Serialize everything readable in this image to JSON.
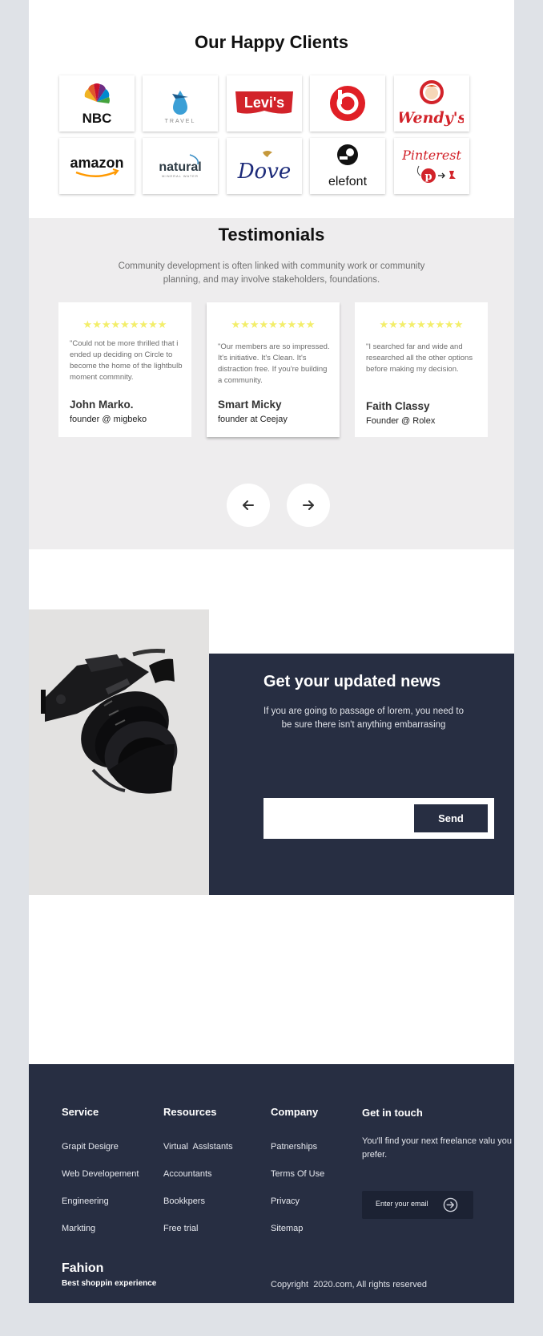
{
  "clients": {
    "title": "Our Happy Clients",
    "logos": [
      {
        "name": "NBC",
        "text": "NBC"
      },
      {
        "name": "Travel",
        "text": "TRAVEL"
      },
      {
        "name": "Levi's",
        "text": "Levi's"
      },
      {
        "name": "Beats",
        "text": "b"
      },
      {
        "name": "Wendy's",
        "text": "Wendy's"
      },
      {
        "name": "Amazon",
        "text": "amazon"
      },
      {
        "name": "Natural",
        "text": "natural",
        "subtext": "MINERAL WATER"
      },
      {
        "name": "Dove",
        "text": "Dove"
      },
      {
        "name": "Elefont",
        "text": "elefont"
      },
      {
        "name": "Pinterest",
        "text": "Pinterest"
      }
    ]
  },
  "testimonials": {
    "title": "Testimonials",
    "subtitle": "Community development is often linked with community work or community planning, and may involve stakeholders, foundations.",
    "stars": "★★★★★★★★★",
    "items": [
      {
        "quote": "\"Could not be more thrilled that i ended up deciding on Circle to become the home of the lightbulb moment commnity.",
        "name": "John Marko.",
        "role": "founder @ migbeko"
      },
      {
        "quote": "\"Our members are so impressed. It's initiative. It's Clean. It's distraction free. If you're building a community.",
        "name": "Smart Micky",
        "role": "founder at Ceejay"
      },
      {
        "quote": "\"I searched far and wide and researched all the other options before making my decision.",
        "name": "Faith Classy",
        "role": "Founder @ Rolex"
      }
    ],
    "prev_label": "←",
    "next_label": "→"
  },
  "newsletter": {
    "title": "Get your updated news",
    "text": "If you are going to passage of lorem, you need to be sure there isn't anything embarrasing",
    "input_value": "",
    "send_label": "Send"
  },
  "footer": {
    "columns": [
      {
        "heading": "Service",
        "links": [
          "Grapit Desigre",
          "Web Developement",
          "Engineering",
          "Markting"
        ]
      },
      {
        "heading": "Resources",
        "links": [
          "Virtual  Asslstants",
          "Accountants",
          "Bookkpers",
          "Free trial"
        ]
      },
      {
        "heading": "Company",
        "links": [
          "Patnerships",
          "Terms Of Use",
          "Privacy",
          "Sitemap"
        ]
      }
    ],
    "get_in_touch": {
      "heading": "Get in touch",
      "text": "You'll find your next freelance valu you prefer.",
      "email_placeholder": "Enter your email"
    },
    "brand": "Fahion",
    "tagline": "Best shoppin experience",
    "copyright": "Copyright  2020.com, All rights reserved"
  },
  "colors": {
    "navy": "#272e42",
    "star": "#f3ee6a",
    "testimonial_bg": "#eeedee",
    "outer_bg": "#dfe2e7"
  }
}
